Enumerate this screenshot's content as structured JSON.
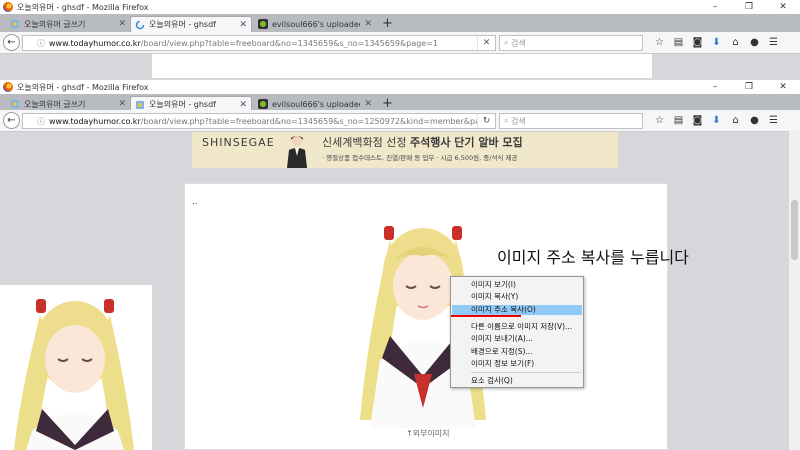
{
  "window": {
    "back": {
      "title": "오늘의유머 - ghsdf - Mozilla Firefox"
    },
    "front": {
      "title": "오늘의유머 - ghsdf - Mozilla Firefox"
    },
    "controls": [
      "–",
      "❐",
      "✕"
    ]
  },
  "tabs_back": [
    {
      "label": "오늘의유머 글쓰기",
      "active": false
    },
    {
      "label": "오늘의유머 - ghsdf",
      "active": true
    },
    {
      "label": "evilsoul666's uploaded i...",
      "active": false
    }
  ],
  "tabs_front": [
    {
      "label": "오늘의유머 글쓰기",
      "active": false
    },
    {
      "label": "오늘의유머 - ghsdf",
      "active": true
    },
    {
      "label": "evilsoul666's uploaded i...",
      "active": false
    }
  ],
  "nav_back": {
    "url_domain": "www.todayhumor.co.kr",
    "url_path": "/board/view.php?table=freeboard&no=1345659&s_no=1345659&page=1",
    "search_placeholder": "검색"
  },
  "nav_front": {
    "url_domain": "www.todayhumor.co.kr",
    "url_path": "/board/view.php?table=freeboard&no=1345659&s_no=1250972&kind=member&pag",
    "search_placeholder": "검색"
  },
  "banner": {
    "brand": "SHINSEGAE",
    "headline_plain": "신세계백화점 선정 ",
    "headline_bold": "주석행사 단기 알바 모집",
    "sub": "· 명절상품 접수데스트, 진열/판매 등 업무  · 시급 6,500원, 중/석식 제공"
  },
  "article": {
    "dots": "..",
    "annotation": "이미지 주소 복사를 누릅니다",
    "caption": "↑외부이미지"
  },
  "context_menu": [
    {
      "label": "이미지 보기(I)",
      "highlighted": false
    },
    {
      "label": "이미지 복사(Y)",
      "highlighted": false
    },
    {
      "label": "이미지 주소 복사(O)",
      "highlighted": true
    },
    {
      "label": "다른 이름으로 이미지 저장(V)...",
      "highlighted": false
    },
    {
      "label": "이미지 보내기(A)...",
      "highlighted": false
    },
    {
      "label": "배경으로 지정(S)...",
      "highlighted": false
    },
    {
      "label": "이미지 정보 보기(F)",
      "highlighted": false
    },
    {
      "label": "요소 검사(Q)",
      "highlighted": false
    }
  ],
  "colors": {
    "highlight": "#91c9f7",
    "underline": "#e00000",
    "hair": "#ecdf8a"
  }
}
